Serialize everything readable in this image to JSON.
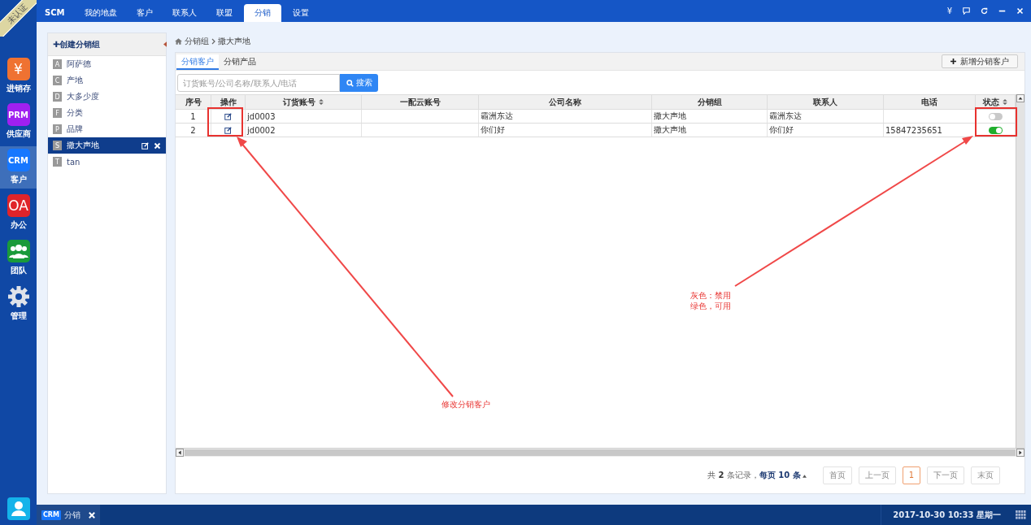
{
  "ribbon": "未认证",
  "top_nav": [
    {
      "label": "SCM",
      "selected": false
    },
    {
      "label": "我的地盘",
      "selected": false
    },
    {
      "label": "客户",
      "selected": false
    },
    {
      "label": "联系人",
      "selected": false
    },
    {
      "label": "联盟",
      "selected": false
    },
    {
      "label": "分销",
      "selected": true
    },
    {
      "label": "设置",
      "selected": false
    }
  ],
  "top_right": {
    "currency": "¥"
  },
  "rail": [
    {
      "kind": "text",
      "icon": "¥",
      "color": "#ef7232",
      "label": "进销存",
      "selected": false
    },
    {
      "kind": "text",
      "icon": "PRM",
      "color": "#a020f0",
      "label": "供应商",
      "selected": false
    },
    {
      "kind": "text",
      "icon": "CRM",
      "color": "#1677ff",
      "label": "客户",
      "selected": true
    },
    {
      "kind": "text",
      "icon": "OA",
      "color": "#e0242a",
      "label": "办公",
      "selected": false
    },
    {
      "kind": "team",
      "color": "#1a9a3a",
      "label": "团队",
      "selected": false
    },
    {
      "kind": "gear",
      "label": "管理",
      "selected": false
    }
  ],
  "groups": {
    "create": "✚创建分销组",
    "items": [
      {
        "letter": "A",
        "name": "阿萨德",
        "selected": false
      },
      {
        "letter": "C",
        "name": "产地",
        "selected": false
      },
      {
        "letter": "D",
        "name": "大多少度",
        "selected": false
      },
      {
        "letter": "F",
        "name": "分类",
        "selected": false
      },
      {
        "letter": "P",
        "name": "品牌",
        "selected": false
      },
      {
        "letter": "S",
        "name": "撒大声地",
        "selected": true
      },
      {
        "letter": "T",
        "name": "tan",
        "selected": false
      }
    ]
  },
  "breadcrumb": [
    "分销组",
    "撒大声地"
  ],
  "tabs": [
    {
      "label": "分销客户",
      "selected": true
    },
    {
      "label": "分销产品",
      "selected": false
    }
  ],
  "add_button": "新增分销客户",
  "search": {
    "placeholder": "订货账号/公司名称/联系人/电话",
    "button": "搜索"
  },
  "table": {
    "columns": [
      {
        "label": "序号",
        "sortable": false
      },
      {
        "label": "操作",
        "sortable": false
      },
      {
        "label": "订货账号",
        "sortable": true
      },
      {
        "label": "一配云账号",
        "sortable": false
      },
      {
        "label": "公司名称",
        "sortable": false
      },
      {
        "label": "分销组",
        "sortable": false
      },
      {
        "label": "联系人",
        "sortable": false
      },
      {
        "label": "电话",
        "sortable": false
      },
      {
        "label": "状态",
        "sortable": true
      }
    ],
    "rows": [
      {
        "no": "1",
        "account": "jd0003",
        "company": "霸洲东达",
        "group": "撒大声地",
        "contact": "霸洲东达",
        "enabled": false
      },
      {
        "no": "2",
        "account": "jd0002",
        "company": "你们好",
        "group": "撒大声地",
        "contact": "你们好",
        "phone": "15847235651",
        "enabled": true
      }
    ]
  },
  "pagination": {
    "summary": "共 **2** 条记录，",
    "page_size": "每页 10 条",
    "buttons": [
      {
        "label": "首页",
        "selected": false
      },
      {
        "label": "上一页",
        "selected": false
      },
      {
        "label": "1",
        "selected": true
      },
      {
        "label": "下一页",
        "selected": false
      },
      {
        "label": "末页",
        "selected": false
      }
    ]
  },
  "annotations": {
    "edit_note": "修改分销客户",
    "status_note": [
      "灰色：禁用",
      "绿色，可用"
    ]
  },
  "taskbar": {
    "task": {
      "badge": "CRM",
      "label": "分销"
    },
    "clock": "2017-10-30 10:33 星期一"
  }
}
